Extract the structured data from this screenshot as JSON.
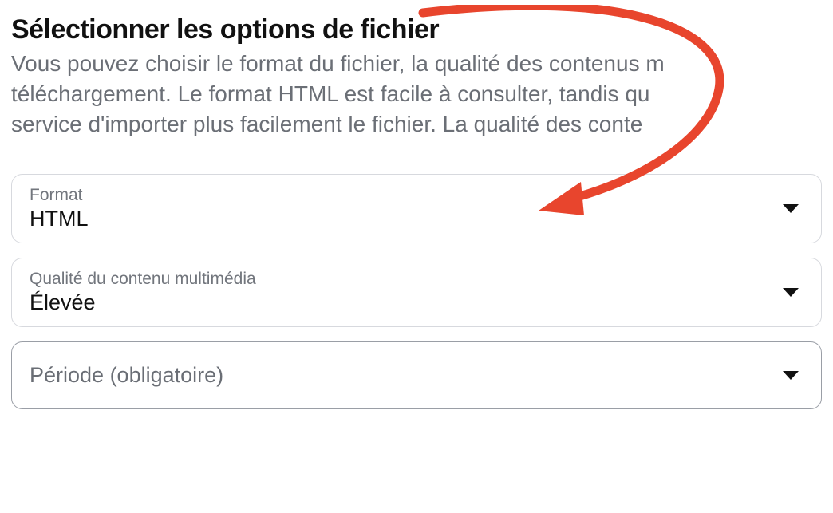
{
  "heading": "Sélectionner les options de fichier",
  "description_lines": [
    "Vous pouvez choisir le format du fichier, la qualité des contenus m",
    "téléchargement. Le format HTML est facile à consulter, tandis qu",
    "service d'importer plus facilement le fichier. La qualité des conte"
  ],
  "fields": {
    "format": {
      "label": "Format",
      "value": "HTML"
    },
    "quality": {
      "label": "Qualité du contenu multimédia",
      "value": "Élevée"
    },
    "period": {
      "label": "Période (obligatoire)"
    }
  },
  "annotation": {
    "stroke": "#e8452d"
  }
}
